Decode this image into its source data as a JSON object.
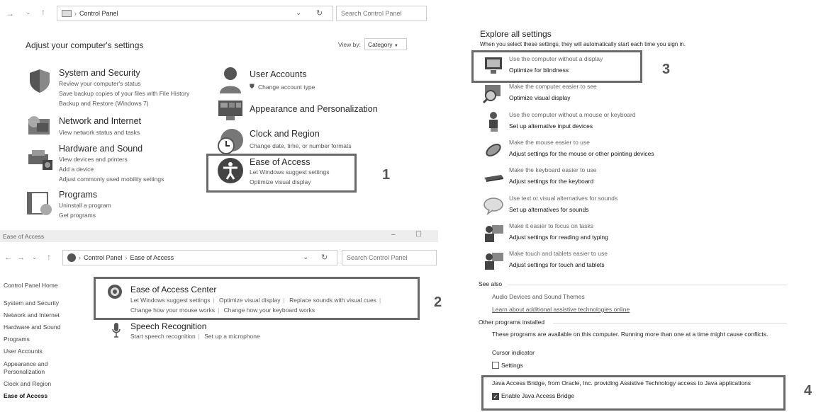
{
  "panel1": {
    "breadcrumb": "Control Panel",
    "search_placeholder": "Search Control Panel",
    "heading": "Adjust your computer's settings",
    "view_by_label": "View by:",
    "view_by_value": "Category",
    "categories_left": [
      {
        "title": "System and Security",
        "links": [
          "Review your computer's status",
          "Save backup copies of your files with File History",
          "Backup and Restore (Windows 7)"
        ]
      },
      {
        "title": "Network and Internet",
        "links": [
          "View network status and tasks"
        ]
      },
      {
        "title": "Hardware and Sound",
        "links": [
          "View devices and printers",
          "Add a device",
          "Adjust commonly used mobility settings"
        ]
      },
      {
        "title": "Programs",
        "links": [
          "Uninstall a program",
          "Get programs"
        ]
      }
    ],
    "categories_right": [
      {
        "title": "User Accounts",
        "links": [
          "Change account type"
        ]
      },
      {
        "title": "Appearance and Personalization",
        "links": []
      },
      {
        "title": "Clock and Region",
        "links": [
          "Change date, time, or number formats"
        ]
      },
      {
        "title": "Ease of Access",
        "links": [
          "Let Windows suggest settings",
          "Optimize visual display"
        ]
      }
    ]
  },
  "panel2": {
    "window_title": "Ease of Access",
    "breadcrumb_root": "Control Panel",
    "breadcrumb_current": "Ease of Access",
    "search_placeholder": "Search Control Panel",
    "sidebar": [
      "Control Panel Home",
      "System and Security",
      "Network and Internet",
      "Hardware and Sound",
      "Programs",
      "User Accounts",
      "Appearance and",
      "Personalization",
      "Clock and Region",
      "Ease of Access"
    ],
    "center": {
      "title": "Ease of Access Center",
      "links_row1": [
        "Let Windows suggest settings",
        "Optimize visual display",
        "Replace sounds with visual cues"
      ],
      "links_row2": [
        "Change how your mouse works",
        "Change how your keyboard works"
      ]
    },
    "speech": {
      "title": "Speech Recognition",
      "links": [
        "Start speech recognition",
        "Set up a microphone"
      ]
    }
  },
  "panel3": {
    "heading": "Explore all settings",
    "subheading": "When you select these settings, they will automatically start each time you sign in.",
    "items": [
      {
        "desc": "Use the computer without a display",
        "action": "Optimize for blindness",
        "icon": "monitor-icon"
      },
      {
        "desc": "Make the computer easier to see",
        "action": "Optimize visual display",
        "icon": "magnifier-icon"
      },
      {
        "desc": "Use the computer without a mouse or keyboard",
        "action": "Set up alternative input devices",
        "icon": "person-icon"
      },
      {
        "desc": "Make the mouse easier to use",
        "action": "Adjust settings for the mouse or other pointing devices",
        "icon": "mouse-icon"
      },
      {
        "desc": "Make the keyboard easier to use",
        "action": "Adjust settings for the keyboard",
        "icon": "keyboard-icon"
      },
      {
        "desc": "Use text or visual alternatives for sounds",
        "action": "Set up alternatives for sounds",
        "icon": "speech-bubble-icon"
      },
      {
        "desc": "Make it easier to focus on tasks",
        "action": "Adjust settings for reading and typing",
        "icon": "people-icon"
      },
      {
        "desc": "Make touch and tablets easier to use",
        "action": "Adjust settings for touch and tablets",
        "icon": "people-icon"
      }
    ],
    "see_also_label": "See also",
    "see_also_links": [
      "Audio Devices and Sound Themes",
      "Learn about additional assistive technologies online"
    ],
    "other_programs_label": "Other programs installed",
    "other_programs_desc": "These programs are available on this computer. Running more than one at a time might cause conflicts.",
    "cursor_indicator_label": "Cursor indicator",
    "settings_checkbox_label": "Settings",
    "java_desc": "Java Access Bridge, from Oracle, Inc. providing Assistive Technology access to Java applications",
    "java_checkbox_label": "Enable Java Access Bridge"
  },
  "callouts": [
    "1",
    "2",
    "3",
    "4"
  ]
}
